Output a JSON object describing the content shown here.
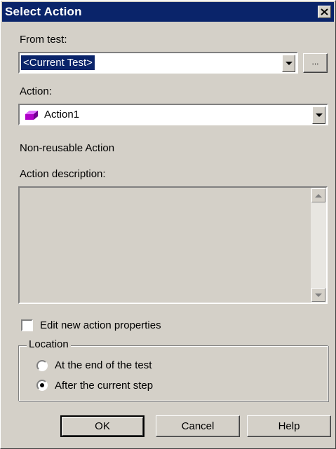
{
  "window": {
    "title": "Select Action",
    "close_icon": "close-x-icon"
  },
  "from_test": {
    "label": "From test:",
    "value": "<Current Test>",
    "browse_label": "..."
  },
  "action": {
    "label": "Action:",
    "value": "Action1",
    "icon": "action-gem-icon",
    "icon_color": "#b000c8"
  },
  "action_type_text": "Non-reusable Action",
  "description": {
    "label": "Action description:",
    "value": ""
  },
  "edit_properties": {
    "label": "Edit new action properties",
    "checked": false
  },
  "location": {
    "legend": "Location",
    "options": [
      {
        "label": "At the end of the test",
        "selected": false
      },
      {
        "label": "After the current step",
        "selected": true
      }
    ]
  },
  "buttons": {
    "ok": "OK",
    "cancel": "Cancel",
    "help": "Help"
  },
  "colors": {
    "titlebar": "#0a246a",
    "face": "#d4d0c8",
    "selection": "#0a246a"
  }
}
